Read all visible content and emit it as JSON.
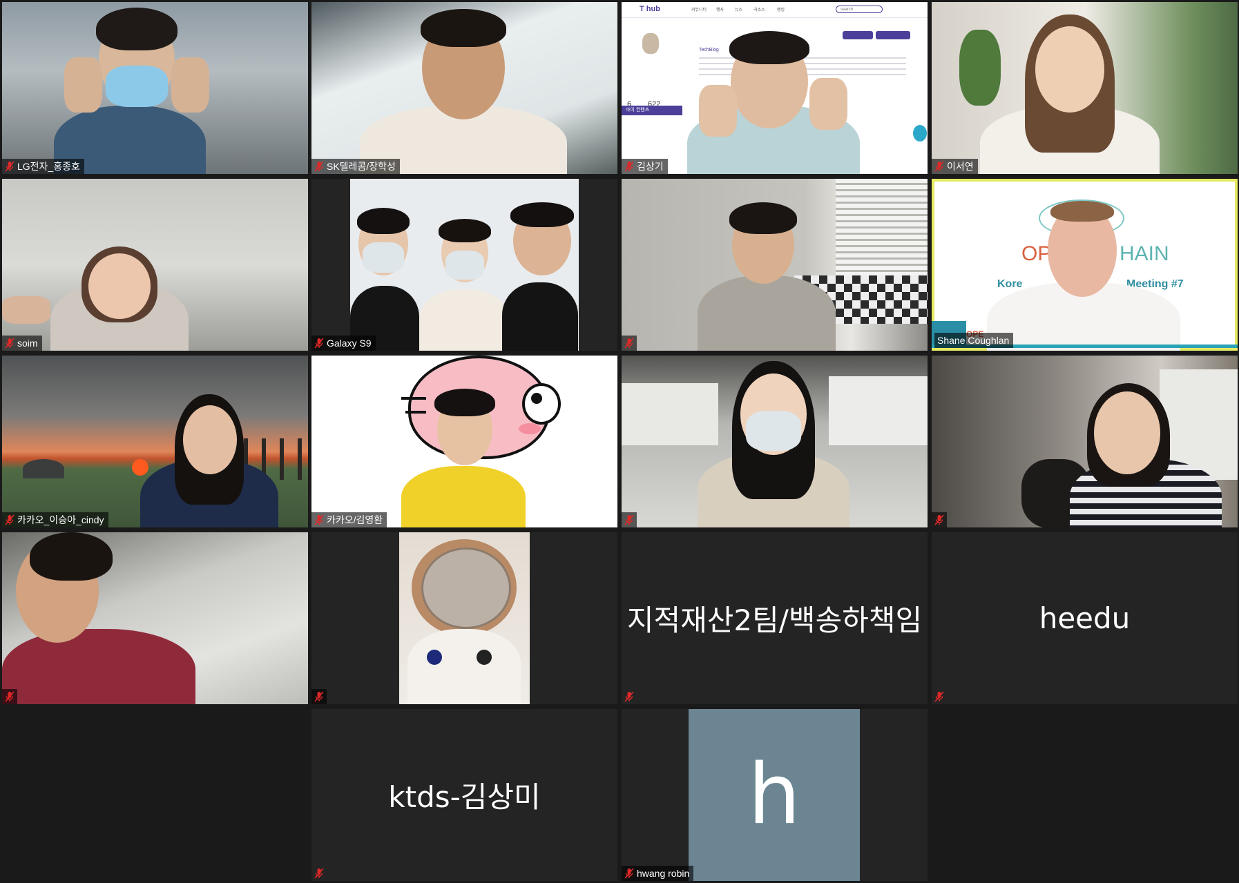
{
  "participants": [
    {
      "name": "LG전자_홍종호"
    },
    {
      "name": "SK텔레콤/장학성"
    },
    {
      "name": "김상기"
    },
    {
      "name": "이서연"
    },
    {
      "name": "soim"
    },
    {
      "name": "Galaxy S9"
    },
    {
      "name": ""
    },
    {
      "name": "Shane Coughlan",
      "slide_lines": [
        "OP",
        "HAIN",
        "Kore",
        "Meeting #7",
        "OPE"
      ]
    },
    {
      "name": "카카오_이승아_cindy"
    },
    {
      "name": "카카오/김영환"
    },
    {
      "name": ""
    },
    {
      "name": ""
    },
    {
      "name": ""
    },
    {
      "name": ""
    },
    {
      "name": "",
      "display_name": "지적재산2팀/백송하책임"
    },
    {
      "name": "",
      "display_name": "heedu"
    },
    {
      "name": "",
      "display_name": "ktds-김상미"
    },
    {
      "name": "hwang robin",
      "avatar_letter": "h"
    }
  ],
  "screen_share": {
    "logo": "T hub",
    "search_placeholder": "search",
    "nav": [
      "커뮤니티",
      "행사",
      "뉴스",
      "리소스",
      "랭킹"
    ],
    "stats": [
      "6",
      "622"
    ],
    "section_label": "TechBlog",
    "side_label": "마이 컨텐츠"
  },
  "colors": {
    "background": "#1a1a1a",
    "tile": "#242424",
    "active_speaker": "#e5ea63",
    "mute_red": "#e02828",
    "avatar_bg": "#6b8593"
  }
}
